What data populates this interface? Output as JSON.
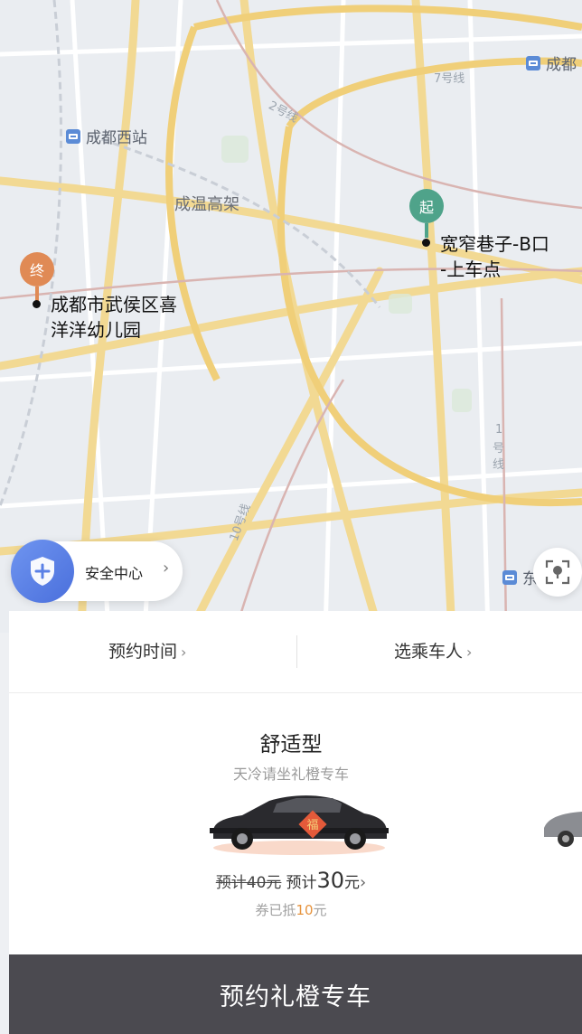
{
  "map": {
    "labels": {
      "highway": "成温高架",
      "line2": "2号线",
      "line7": "7号线",
      "line10": "10号线",
      "line1a": "1",
      "line1b": "号",
      "line1c": "线"
    },
    "stations": {
      "west": "成都西站",
      "top_right": "成都",
      "bottom_right": "东"
    },
    "start_pin": {
      "marker": "起",
      "name_line1": "宽窄巷子-B口",
      "name_line2": "-上车点"
    },
    "end_pin": {
      "marker": "终",
      "name_line1": "成都市武侯区喜",
      "name_line2": "洋洋幼儿园"
    },
    "safety_center": "安全中心",
    "chevron": "›"
  },
  "options": {
    "reserve_time": "预约时间",
    "select_passenger": "选乘车人",
    "chevron": "›"
  },
  "car": {
    "type": "舒适型",
    "slogan": "天冷请坐礼橙专车",
    "badge": "福",
    "old_price": "预计40元",
    "new_price_prefix": "预计",
    "new_price_value": "30",
    "new_price_unit": "元",
    "chevron": "›",
    "coupon_prefix": "券已抵",
    "coupon_amount": "10",
    "coupon_unit": "元"
  },
  "cta": {
    "label": "预约礼橙专车"
  },
  "colors": {
    "start_pin": "#4fa38a",
    "end_pin": "#e08a55",
    "cta_bg": "#4b4a50",
    "coupon": "#e6943f",
    "road": "#f2d993"
  }
}
